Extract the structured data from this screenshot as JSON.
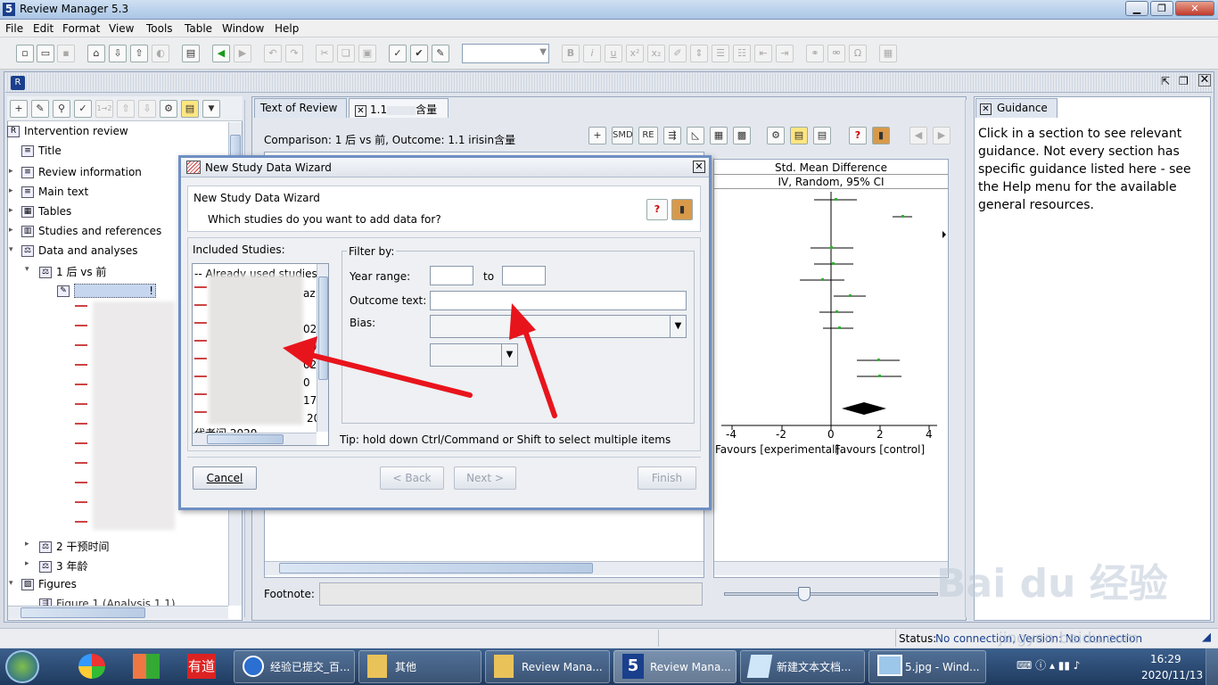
{
  "window": {
    "title": "Review Manager 5.3",
    "app_icon": "5"
  },
  "menu": [
    "File",
    "Edit",
    "Format",
    "View",
    "Tools",
    "Table",
    "Window",
    "Help"
  ],
  "toolbar": {
    "format_bold": "B",
    "format_italic": "i",
    "format_underline": "u",
    "format_super": "x²",
    "format_sub": "x₂",
    "symbol": "Ω"
  },
  "tree": {
    "root": "Intervention review",
    "items": [
      "Title",
      "Review information",
      "Main text",
      "Tables",
      "Studies and references",
      "Data and analyses"
    ],
    "comparisons": [
      "1 后 vs 前",
      "2 干预时间",
      "3 年龄"
    ],
    "figures_label": "Figures",
    "figure1": "Figure 1 (Analysis 1.1)",
    "analysis_label": "!"
  },
  "center": {
    "tab1": "Text of Review",
    "tab2": "1.1",
    "tab2b": "含量",
    "comparison": "Comparison: 1 后 vs 前, Outcome: 1.1 irisin含量",
    "tools": [
      "SMD",
      "RE"
    ],
    "footnote_label": "Footnote:"
  },
  "forest": {
    "header1": "Std. Mean Difference",
    "header2": "IV, Random, 95% CI",
    "ticks": [
      "-4",
      "-2",
      "0",
      "2",
      "4"
    ],
    "favours_left": "Favours [experimental]",
    "favours_right": "Favours [control]"
  },
  "guidance": {
    "tab": "Guidance",
    "text": "Click in a section to see relevant guidance. Not every section has specific guidance listed here - see the Help menu for the available general resources."
  },
  "dialog": {
    "title": "New Study Data Wizard",
    "heading": "New Study Data Wizard",
    "question": "Which studies do you want to add data for?",
    "included_label": "Included Studies:",
    "list_header": "-- Already used studies",
    "list_suffixes": [
      "az",
      "",
      "020",
      "20",
      "020",
      "0",
      "17",
      "20"
    ],
    "list_last": "代老问 2020",
    "filter_label": "Filter by:",
    "year_range_label": "Year range:",
    "year_from": "",
    "to_label": "to",
    "year_to": "",
    "outcome_label": "Outcome text:",
    "outcome_value": "",
    "bias_label": "Bias:",
    "tip": "Tip: hold down Ctrl/Command or Shift to select multiple items",
    "cancel": "Cancel",
    "back": "< Back",
    "next": "Next >",
    "finish": "Finish"
  },
  "status": {
    "label": "Status:",
    "value": "No connection, Version: No connection"
  },
  "taskbar": {
    "tasks": [
      "经验已提交_百...",
      "其他",
      "Review Mana...",
      "Review Mana...",
      "新建文本文档...",
      "5.jpg - Wind..."
    ],
    "time": "16:29",
    "date": "2020/11/13",
    "quick_launch": [
      "有道"
    ]
  },
  "watermark": "jingyan.baidu.com",
  "colors": {
    "accent_arrow": "#e8141c",
    "dialog_border": "#6f8fc4",
    "forest_point": "#2fb52f"
  }
}
